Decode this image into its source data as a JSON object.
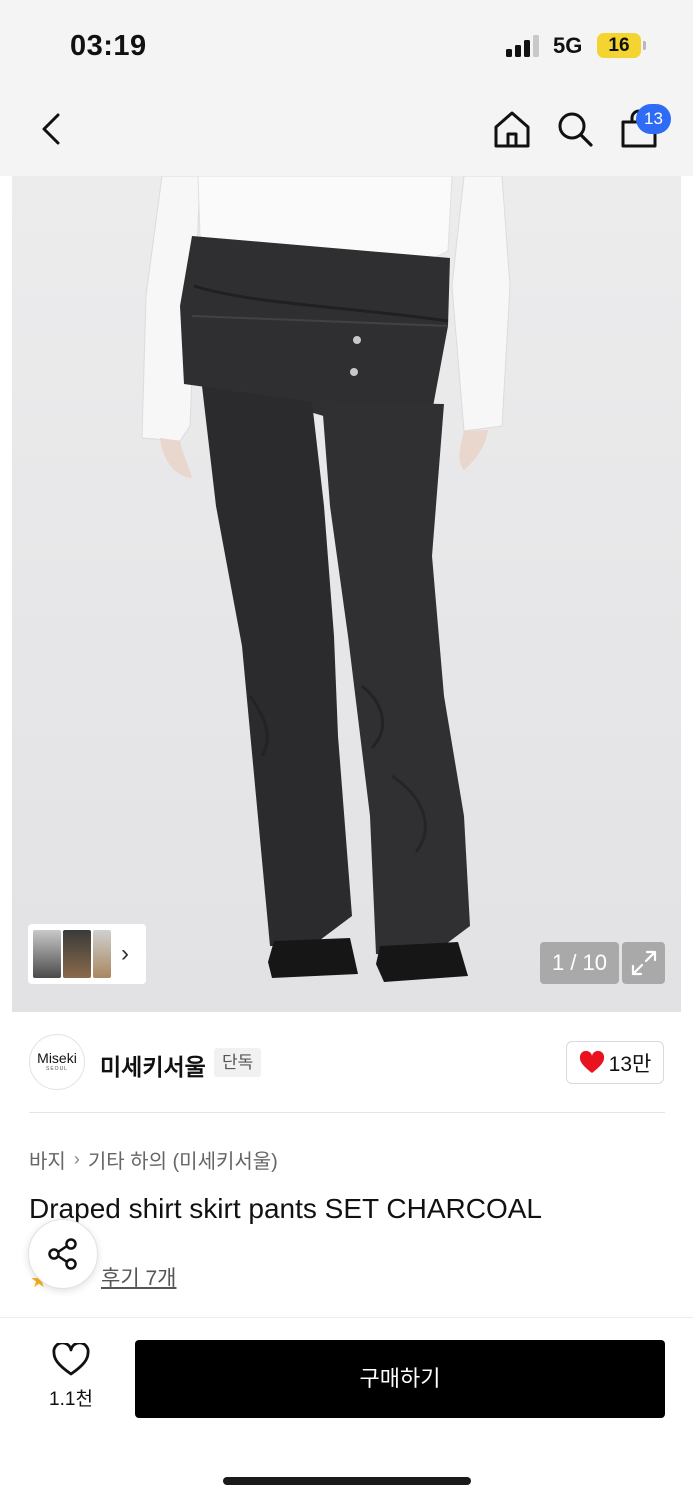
{
  "status_bar": {
    "time": "03:19",
    "network": "5G",
    "battery": "16",
    "battery_color": "#f3d431"
  },
  "nav": {
    "back_icon": "chevron-left-icon",
    "home_icon": "home-icon",
    "search_icon": "search-icon",
    "cart_icon": "shopping-bag-icon",
    "cart_count": "13",
    "badge_color": "#2e6cf6"
  },
  "gallery": {
    "counter": "1 / 10",
    "expand_icon": "expand-icon",
    "thumbnail_chevron": "›"
  },
  "brand": {
    "logo_text": "Miseki",
    "logo_subtext": "SEOUL",
    "name": "미세키서울",
    "tag": "단독",
    "likes": "13만"
  },
  "product": {
    "breadcrumb": [
      "바지",
      "기타 하의 (미세키서울)"
    ],
    "title": "Draped shirt skirt pants SET CHARCOAL",
    "review_link": "후기 7개"
  },
  "actions": {
    "wish_count": "1.1천",
    "buy_label": "구매하기"
  }
}
